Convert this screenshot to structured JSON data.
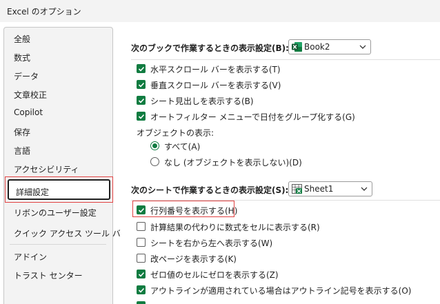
{
  "window": {
    "title": "Excel のオプション"
  },
  "nav": {
    "items": [
      {
        "label": "全般"
      },
      {
        "label": "数式"
      },
      {
        "label": "データ"
      },
      {
        "label": "文章校正"
      },
      {
        "label": "Copilot"
      },
      {
        "label": "保存"
      },
      {
        "label": "言語"
      },
      {
        "label": "アクセシビリティ"
      },
      {
        "label": "詳細設定"
      },
      {
        "label": "リボンのユーザー設定"
      },
      {
        "label": "クイック アクセス ツール バー"
      },
      {
        "label": "アドイン"
      },
      {
        "label": "トラスト センター"
      }
    ],
    "selected": "詳細設定"
  },
  "workbook_section": {
    "header": "次のブックで作業するときの表示設定(B):",
    "dropdown_value": "Book2",
    "options": [
      {
        "label": "水平スクロール バーを表示する(T)",
        "checked": true
      },
      {
        "label": "垂直スクロール バーを表示する(V)",
        "checked": true
      },
      {
        "label": "シート見出しを表示する(B)",
        "checked": true
      },
      {
        "label": "オートフィルター メニューで日付をグループ化する(G)",
        "checked": true
      }
    ],
    "objects_label": "オブジェクトの表示:",
    "radios": [
      {
        "label": "すべて(A)",
        "selected": true
      },
      {
        "label": "なし (オブジェクトを表示しない)(D)",
        "selected": false
      }
    ]
  },
  "sheet_section": {
    "header": "次のシートで作業するときの表示設定(S):",
    "dropdown_value": "Sheet1",
    "options": [
      {
        "label": "行列番号を表示する(H)",
        "checked": true
      },
      {
        "label": "計算結果の代わりに数式をセルに表示する(R)",
        "checked": false
      },
      {
        "label": "シートを右から左へ表示する(W)",
        "checked": false
      },
      {
        "label": "改ページを表示する(K)",
        "checked": false
      },
      {
        "label": "ゼロ値のセルにゼロを表示する(Z)",
        "checked": true
      },
      {
        "label": "アウトラインが適用されている場合はアウトライン記号を表示する(O)",
        "checked": true
      }
    ]
  },
  "colors": {
    "accent": "#107c41",
    "highlight": "#e04040"
  },
  "icons": {
    "excel": "excel-file-icon",
    "chevron": "chevron-down-icon",
    "check": "checkmark-icon"
  }
}
